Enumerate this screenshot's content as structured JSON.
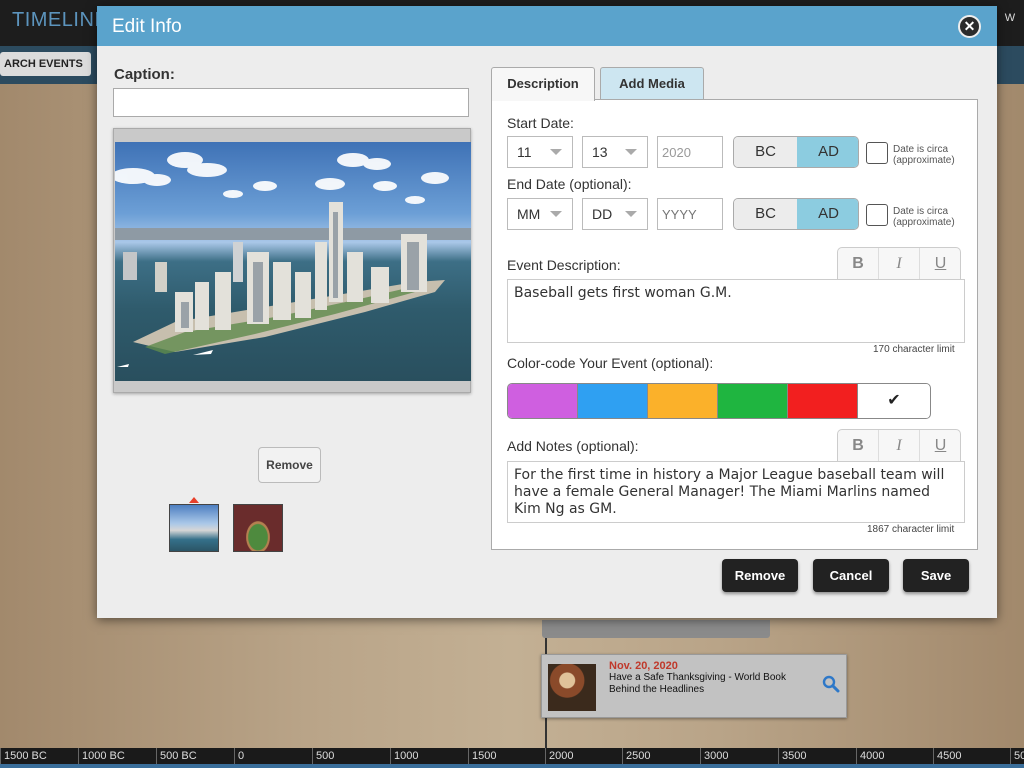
{
  "app": {
    "title": "TIMELINE",
    "top_right_text": "W"
  },
  "toolbar": {
    "search_events_label": "ARCH EVENTS"
  },
  "timeline": {
    "event": {
      "date": "Nov. 20, 2020",
      "title": "Have a Safe Thanksgiving - World Book Behind the Headlines",
      "icon": "search-icon"
    },
    "axis_ticks": [
      "1500 BC",
      "1000 BC",
      "500 BC",
      "0",
      "500",
      "1000",
      "1500",
      "2000",
      "2500",
      "3000",
      "3500",
      "4000",
      "4500",
      "50"
    ]
  },
  "modal": {
    "title": "Edit Info",
    "close_icon": "close-icon",
    "caption_label": "Caption:",
    "caption_value": "",
    "remove_photo_label": "Remove",
    "tabs": [
      {
        "label": "Description",
        "active": true
      },
      {
        "label": "Add Media",
        "active": false
      }
    ],
    "start_date": {
      "label": "Start Date:",
      "month": "11",
      "day": "13",
      "year": "2020",
      "era_options": [
        "BC",
        "AD"
      ],
      "selected_era": "AD",
      "circa_label": "Date is circa (approximate)",
      "circa_checked": false
    },
    "end_date": {
      "label": "End Date (optional):",
      "month": "MM",
      "day": "DD",
      "year_placeholder": "YYYY",
      "era_options": [
        "BC",
        "AD"
      ],
      "selected_era": "AD",
      "circa_label": "Date is circa (approximate)",
      "circa_checked": false
    },
    "event_description": {
      "label": "Event Description:",
      "value": "Baseball gets first woman G.M.",
      "limit": "170 character limit"
    },
    "format_buttons": [
      "B",
      "I",
      "U"
    ],
    "color_code": {
      "label": "Color-code Your Event (optional):",
      "colors": [
        "#cf5fe0",
        "#2fa0f2",
        "#fbb12a",
        "#1fb540",
        "#f21f1f"
      ],
      "selected_mark": "✔"
    },
    "notes": {
      "label": "Add Notes (optional):",
      "value": "For the first time in history a Major League baseball team will have a female General Manager! The Miami Marlins named Kim Ng as GM.",
      "limit": "1867 character limit"
    },
    "actions": {
      "remove": "Remove",
      "cancel": "Cancel",
      "save": "Save"
    }
  }
}
